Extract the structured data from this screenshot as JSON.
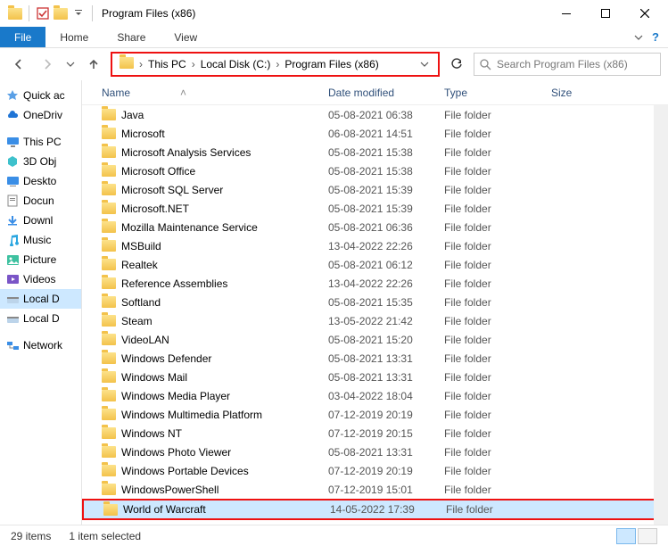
{
  "window": {
    "title": "Program Files (x86)"
  },
  "ribbon": {
    "file": "File",
    "tabs": [
      "Home",
      "Share",
      "View"
    ]
  },
  "breadcrumbs": [
    "This PC",
    "Local Disk (C:)",
    "Program Files (x86)"
  ],
  "search": {
    "placeholder": "Search Program Files (x86)"
  },
  "sidebar": {
    "groups": [
      [
        {
          "label": "Quick ac",
          "icon": "star"
        },
        {
          "label": "OneDriv",
          "icon": "cloud"
        }
      ],
      [
        {
          "label": "This PC",
          "icon": "pc"
        },
        {
          "label": "3D Obj",
          "icon": "cube"
        },
        {
          "label": "Deskto",
          "icon": "desktop"
        },
        {
          "label": "Docun",
          "icon": "doc"
        },
        {
          "label": "Downl",
          "icon": "down"
        },
        {
          "label": "Music",
          "icon": "music"
        },
        {
          "label": "Picture",
          "icon": "pic"
        },
        {
          "label": "Videos",
          "icon": "video"
        },
        {
          "label": "Local D",
          "icon": "disk",
          "selected": true
        },
        {
          "label": "Local D",
          "icon": "disk"
        }
      ],
      [
        {
          "label": "Network",
          "icon": "net"
        }
      ]
    ]
  },
  "columns": {
    "name": "Name",
    "date": "Date modified",
    "type": "Type",
    "size": "Size"
  },
  "rows": [
    {
      "name": "Java",
      "date": "05-08-2021 06:38",
      "type": "File folder"
    },
    {
      "name": "Microsoft",
      "date": "06-08-2021 14:51",
      "type": "File folder"
    },
    {
      "name": "Microsoft Analysis Services",
      "date": "05-08-2021 15:38",
      "type": "File folder"
    },
    {
      "name": "Microsoft Office",
      "date": "05-08-2021 15:38",
      "type": "File folder"
    },
    {
      "name": "Microsoft SQL Server",
      "date": "05-08-2021 15:39",
      "type": "File folder"
    },
    {
      "name": "Microsoft.NET",
      "date": "05-08-2021 15:39",
      "type": "File folder"
    },
    {
      "name": "Mozilla Maintenance Service",
      "date": "05-08-2021 06:36",
      "type": "File folder"
    },
    {
      "name": "MSBuild",
      "date": "13-04-2022 22:26",
      "type": "File folder"
    },
    {
      "name": "Realtek",
      "date": "05-08-2021 06:12",
      "type": "File folder"
    },
    {
      "name": "Reference Assemblies",
      "date": "13-04-2022 22:26",
      "type": "File folder"
    },
    {
      "name": "Softland",
      "date": "05-08-2021 15:35",
      "type": "File folder"
    },
    {
      "name": "Steam",
      "date": "13-05-2022 21:42",
      "type": "File folder"
    },
    {
      "name": "VideoLAN",
      "date": "05-08-2021 15:20",
      "type": "File folder"
    },
    {
      "name": "Windows Defender",
      "date": "05-08-2021 13:31",
      "type": "File folder"
    },
    {
      "name": "Windows Mail",
      "date": "05-08-2021 13:31",
      "type": "File folder"
    },
    {
      "name": "Windows Media Player",
      "date": "03-04-2022 18:04",
      "type": "File folder"
    },
    {
      "name": "Windows Multimedia Platform",
      "date": "07-12-2019 20:19",
      "type": "File folder"
    },
    {
      "name": "Windows NT",
      "date": "07-12-2019 20:15",
      "type": "File folder"
    },
    {
      "name": "Windows Photo Viewer",
      "date": "05-08-2021 13:31",
      "type": "File folder"
    },
    {
      "name": "Windows Portable Devices",
      "date": "07-12-2019 20:19",
      "type": "File folder"
    },
    {
      "name": "WindowsPowerShell",
      "date": "07-12-2019 15:01",
      "type": "File folder"
    },
    {
      "name": "World of Warcraft",
      "date": "14-05-2022 17:39",
      "type": "File folder",
      "selected": true
    }
  ],
  "status": {
    "count": "29 items",
    "selected": "1 item selected"
  }
}
